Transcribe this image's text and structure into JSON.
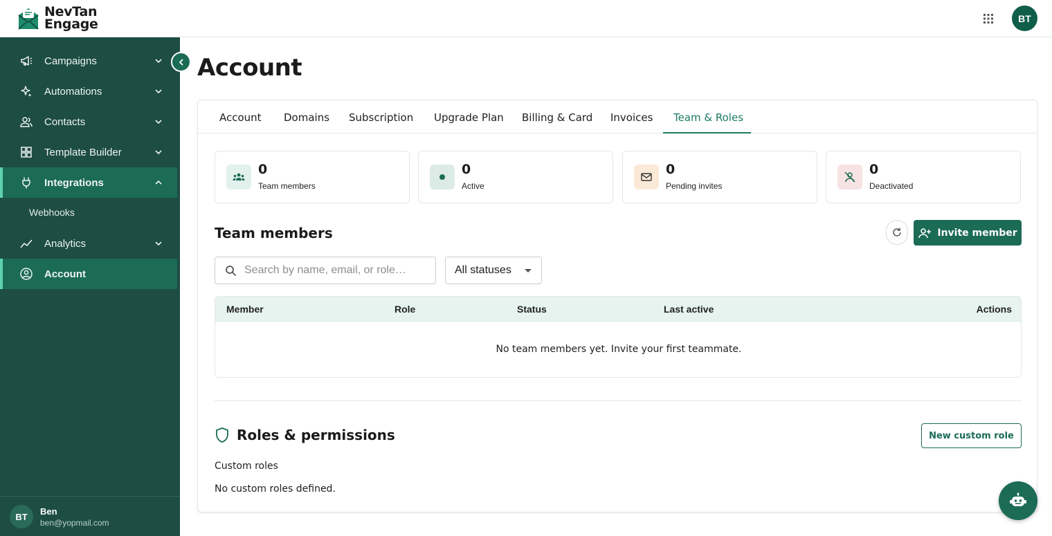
{
  "brand": {
    "line1": "NevTan",
    "line2": "Engage"
  },
  "topbar": {
    "avatar_initials": "BT"
  },
  "sidebar": {
    "items": [
      {
        "label": "Campaigns",
        "icon": "megaphone-icon"
      },
      {
        "label": "Automations",
        "icon": "sparkles-icon"
      },
      {
        "label": "Contacts",
        "icon": "users-icon"
      },
      {
        "label": "Template Builder",
        "icon": "grid-icon"
      },
      {
        "label": "Integrations",
        "icon": "plug-icon"
      },
      {
        "label": "Analytics",
        "icon": "chart-line-icon"
      },
      {
        "label": "Account",
        "icon": "user-circle-icon"
      }
    ],
    "sub_item": "Webhooks",
    "user": {
      "initials": "BT",
      "name": "Ben",
      "email": "ben@yopmail.com"
    }
  },
  "page": {
    "title": "Account"
  },
  "tabs": [
    "Account",
    "Domains",
    "Subscription",
    "Upgrade Plan",
    "Billing & Card",
    "Invoices",
    "Team & Roles"
  ],
  "active_tab": "Team & Roles",
  "stats": [
    {
      "value": "0",
      "label": "Team members"
    },
    {
      "value": "0",
      "label": "Active"
    },
    {
      "value": "0",
      "label": "Pending invites"
    },
    {
      "value": "0",
      "label": "Deactivated"
    }
  ],
  "team": {
    "title": "Team members",
    "invite_label": "Invite member",
    "search_placeholder": "Search by name, email, or role…",
    "status_filter": "All statuses",
    "columns": [
      "Member",
      "Role",
      "Status",
      "Last active",
      "Actions"
    ],
    "empty_text": "No team members yet. Invite your first teammate."
  },
  "roles": {
    "title": "Roles & permissions",
    "new_role_label": "New custom role",
    "custom_roles_label": "Custom roles",
    "empty_text": "No custom roles defined."
  },
  "colors": {
    "primary": "#1b6b55",
    "sidebar": "#1d4d43",
    "accent": "#1b7a62"
  }
}
